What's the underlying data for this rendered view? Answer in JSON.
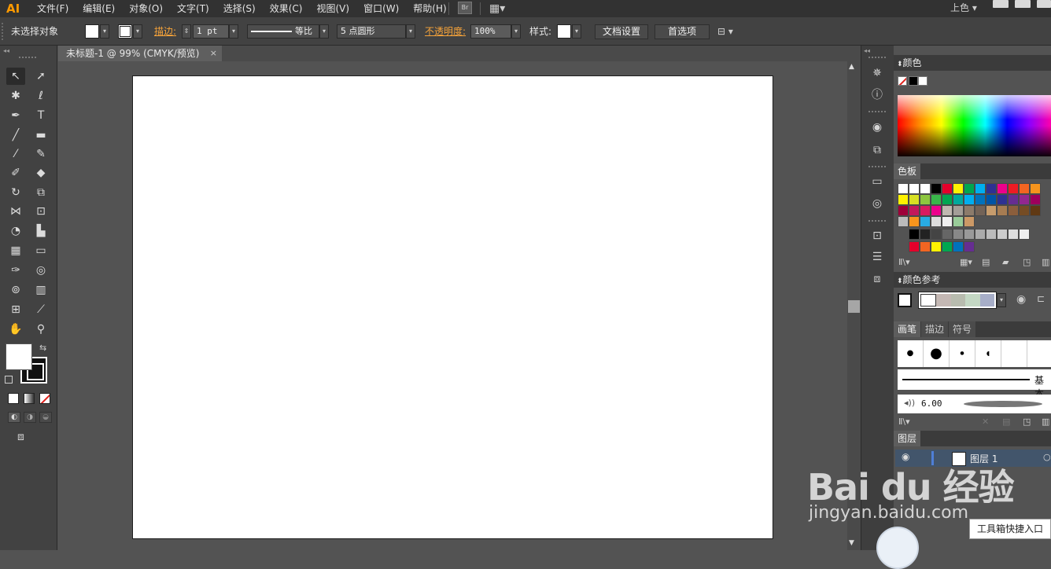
{
  "app": {
    "logo": "AI",
    "workspace": "上色 ▾"
  },
  "menu": [
    "文件(F)",
    "编辑(E)",
    "对象(O)",
    "文字(T)",
    "选择(S)",
    "效果(C)",
    "视图(V)",
    "窗口(W)",
    "帮助(H)"
  ],
  "bridge_button": "Br",
  "control": {
    "selection_status": "未选择对象",
    "stroke_label": "描边:",
    "stroke_weight": "1 pt",
    "stroke_profile": "等比",
    "brush": "5 点圆形",
    "opacity_label": "不透明度:",
    "opacity_value": "100%",
    "style_label": "样式:",
    "doc_setup_button": "文档设置",
    "preferences_button": "首选项"
  },
  "document": {
    "tab_title": "未标题-1 @ 99% (CMYK/预览)",
    "close_glyph": "×"
  },
  "panels": {
    "color": {
      "title": "颜色"
    },
    "swatches": {
      "title": "色板"
    },
    "color_guide": {
      "title": "颜色参考"
    },
    "brush_tabs": [
      "画笔",
      "描边",
      "符号"
    ],
    "brush_basic_label": "基本",
    "brush_size": "6.00",
    "layers": {
      "title": "图层",
      "layer_name": "图层 1"
    }
  },
  "watermark": {
    "brand": "Bai du 经验",
    "url": "jingyan.baidu.com"
  },
  "tooltip": "工具箱快捷入口",
  "colors": {
    "accent": "#f7a43a",
    "panel_bg": "#424242",
    "canvas_bg": "#535353",
    "artboard": "#ffffff"
  }
}
